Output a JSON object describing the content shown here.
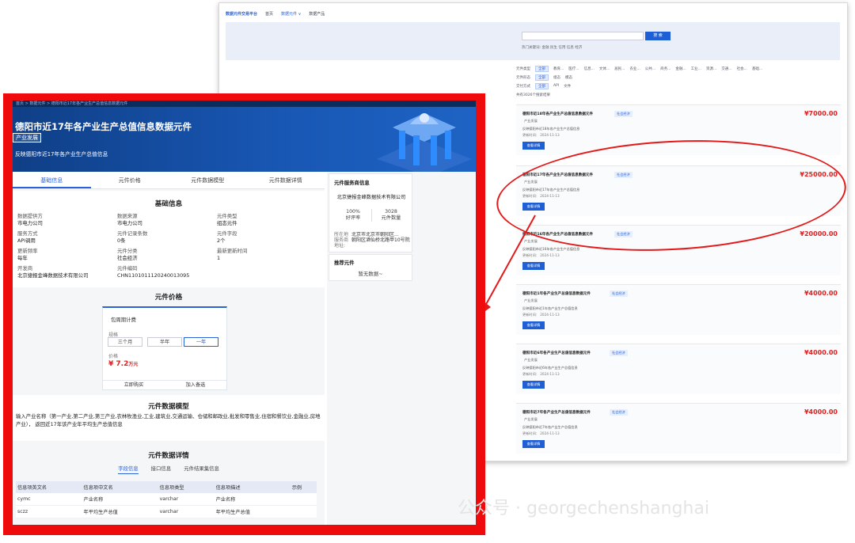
{
  "background": {
    "nav": {
      "logo": "数据元件交易平台",
      "items": [
        "首页",
        "数据元件 ∨",
        "数据产品"
      ]
    },
    "search": {
      "button": "搜 索",
      "hot_label": "热门关键词:",
      "hot_tags": [
        "金融",
        "民生",
        "信用",
        "信息",
        "经济"
      ]
    },
    "filters": [
      {
        "label": "元件类型",
        "selected": "全部",
        "options": [
          "教育...",
          "医疗...",
          "信息...",
          "文体...",
          "居民...",
          "农业...",
          "公共...",
          "商务...",
          "金融...",
          "工业...",
          "资源...",
          "交通...",
          "社会...",
          "基础..."
        ]
      },
      {
        "label": "元件形态",
        "selected": "全部",
        "options": [
          "组态",
          "模态"
        ]
      },
      {
        "label": "交付方式",
        "selected": "全部",
        "options": [
          "API",
          "文件"
        ]
      }
    ],
    "result_count": "共有3026个搜索结果",
    "cards": [
      {
        "title": "德阳市近18年各产业生产总值信息数据元件",
        "tag": "社会经济",
        "price": "¥7000.00",
        "category": "产业发展",
        "desc": "反映德阳市近18年各产业生产总值信息",
        "update": "更新时间： 2024-11-13",
        "button": "查看详情"
      },
      {
        "title": "德阳市近17年各产业生产总值信息数据元件",
        "tag": "社会经济",
        "price": "¥25000.00",
        "category": "产业发展",
        "desc": "反映德阳市近17年各产业生产总值信息",
        "update": "更新时间： 2024-11-13",
        "button": "查看详情"
      },
      {
        "title": "德阳市近16年各产业生产总值信息数据元件",
        "tag": "社会经济",
        "price": "¥20000.00",
        "category": "产业发展",
        "desc": "反映德阳市近16年各产业生产总值信息",
        "update": "更新时间： 2024-11-13",
        "button": "查看详情"
      },
      {
        "title": "德阳市近1年各产业生产总值信息数据元件",
        "tag": "社会经济",
        "price": "¥4000.00",
        "category": "产业发展",
        "desc": "反映德阳市近1年各产业生产总值信息",
        "update": "更新时间： 2024-11-13",
        "button": "查看详情"
      },
      {
        "title": "德阳市近6年各产业生产总值信息数据元件",
        "tag": "社会经济",
        "price": "¥4000.00",
        "category": "产业发展",
        "desc": "反映德阳市近6年各产业生产总值信息",
        "update": "更新时间： 2024-11-13",
        "button": "查看详情"
      },
      {
        "title": "德阳市近7年各产业生产总值信息数据元件",
        "tag": "社会经济",
        "price": "¥4000.00",
        "category": "产业发展",
        "desc": "反映德阳市近7年各产业生产总值信息",
        "update": "更新时间： 2024-11-13",
        "button": "查看详情"
      }
    ]
  },
  "detail": {
    "breadcrumb": "首页 > 数据元件 > 德阳市近17年各产业生产总值信息数据元件",
    "title": "德阳市近17年各产业生产总值信息数据元件",
    "tag": "产业发展",
    "summary": "反映德阳市近17年各产业生产总值信息",
    "tabs": [
      "基础信息",
      "元件价格",
      "元件数据模型",
      "元件数据详情"
    ],
    "basic": {
      "title": "基础信息",
      "fields": [
        {
          "label": "数据提供方",
          "value": "市电力公司"
        },
        {
          "label": "数据来源",
          "value": "市电力公司"
        },
        {
          "label": "元件类型",
          "value": "组态元件"
        },
        {
          "label": "服务方式",
          "value": "API调用"
        },
        {
          "label": "元件记录条数",
          "value": "0条"
        },
        {
          "label": "元件字段",
          "value": "2个"
        },
        {
          "label": "更新频率",
          "value": "每年"
        },
        {
          "label": "元件分类",
          "value": "社会经济"
        },
        {
          "label": "最新更新时间",
          "value": "1"
        },
        {
          "label": "开发商",
          "value": "北京捷报金峰数据技术有限公司"
        },
        {
          "label": "元件编码",
          "value": "CHN1101011120240013095"
        }
      ]
    },
    "price": {
      "title": "元件价格",
      "plan": "包周期计费",
      "spec_label": "规格",
      "options": [
        "三个月",
        "半年",
        "一年"
      ],
      "selected": "一年",
      "price_label": "价格",
      "price_value": "¥ 7.2",
      "price_unit": "万元",
      "buy": "立即购买",
      "cart": "加入备选"
    },
    "model": {
      "title": "元件数据模型",
      "text": "输入产业名称（第一产业,第二产业,第三产业,农林牧渔业,工业,建筑业,交通运输、仓储和邮政业,批发和零售业,住宿和餐饮业,金融业,房地产业）， 返回近17年该产业年平均生产总值信息"
    },
    "details": {
      "title": "元件数据详情",
      "subtabs": [
        "字段信息",
        "接口信息",
        "元件结果集信息"
      ],
      "columns": [
        "信息项英文名",
        "信息项中文名",
        "信息项类型",
        "信息项描述",
        "示例"
      ],
      "rows": [
        [
          "cymc",
          "产业名称",
          "varchar",
          "产业名称",
          ""
        ],
        [
          "sczz",
          "年平均生产总值",
          "varchar",
          "年平均生产总值",
          ""
        ]
      ]
    },
    "provider": {
      "title": "元件服务商信息",
      "name": "北京捷报金峰数据技术有限公司",
      "rating_value": "100%",
      "rating_label": "好评率",
      "count_value": "3028",
      "count_label": "元件数量",
      "location_label": "所在地 服务商地址:",
      "location_value": "北京市北京市朝阳区...\n朝阳区酒仙桥北路甲10号院"
    },
    "recommend": {
      "title": "推荐元件",
      "empty": "暂无数据~"
    }
  },
  "watermark": "公众号 · georgechenshanghai",
  "colors": {
    "accent": "#2a62d8",
    "highlight_red": "#e41919",
    "price_red": "#e02020",
    "hero_blue": "#1856b2"
  }
}
